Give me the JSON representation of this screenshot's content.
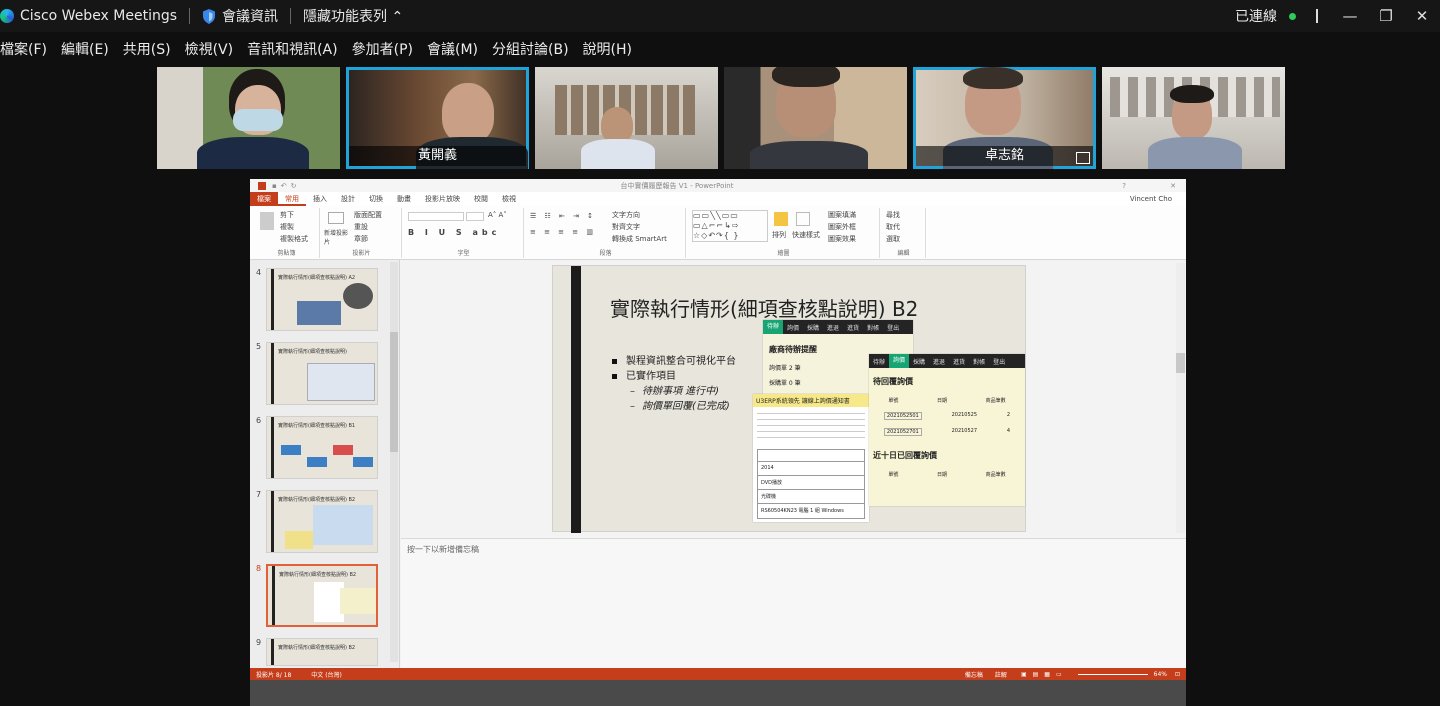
{
  "titlebar": {
    "app_name": "Cisco Webex Meetings",
    "meeting_info": "會議資訊",
    "hide_menu": "隱藏功能表列",
    "status": "已連線"
  },
  "menu": [
    "檔案(F)",
    "編輯(E)",
    "共用(S)",
    "檢視(V)",
    "音訊和視訊(A)",
    "參加者(P)",
    "會議(M)",
    "分組討論(B)",
    "說明(H)"
  ],
  "participants": [
    {
      "name": "",
      "active": false
    },
    {
      "name": "黃開義",
      "active": true
    },
    {
      "name": "",
      "active": false
    },
    {
      "name": "",
      "active": false
    },
    {
      "name": "卓志銘",
      "active": true
    },
    {
      "name": "",
      "active": false
    }
  ],
  "ppt": {
    "title": "台中實價履歷報告 V1 - PowerPoint",
    "user": "Vincent Cho",
    "tabs": [
      "檔案",
      "常用",
      "插入",
      "設計",
      "切換",
      "動畫",
      "投影片放映",
      "校閱",
      "檢視"
    ],
    "ribbon": {
      "clipboard": "剪貼簿",
      "cut": "剪下",
      "copy": "複製",
      "format_painter": "複製格式",
      "slides": "投影片",
      "new_slide": "新增投影片",
      "layout": "版面配置",
      "reset": "重設",
      "section": "章節",
      "font": "字型",
      "paragraph": "段落",
      "text_direction": "文字方向",
      "align_text": "對齊文字",
      "smartart": "轉換成 SmartArt",
      "drawing": "繪圖",
      "arrange": "排列",
      "quick_styles": "快速樣式",
      "shape_fill": "圖案填滿",
      "shape_outline": "圖案外框",
      "shape_effects": "圖案效果",
      "editing": "編輯",
      "find": "尋找",
      "replace": "取代",
      "select": "選取"
    },
    "thumbs": [
      {
        "num": "4",
        "title": "實際執行情形(細項查核點說明) A2"
      },
      {
        "num": "5",
        "title": "實際執行情形(細項查核點說明)"
      },
      {
        "num": "6",
        "title": "實際執行情形(細項查核點說明) B1"
      },
      {
        "num": "7",
        "title": "實際執行情形(細項查核點說明) B2"
      },
      {
        "num": "8",
        "title": "實際執行情形(細項查核點說明) B2"
      },
      {
        "num": "9",
        "title": "實際執行情形(細項查核點說明) B2"
      }
    ],
    "slide": {
      "title": "實際執行情形(細項查核點說明) B2",
      "bullets": [
        "製程資訊整合可視化平台",
        "已實作項目"
      ],
      "sub_bullets": [
        "待辦事項 進行中)",
        "詢價單回覆(已完成)"
      ],
      "shot1": {
        "nav": [
          "待辦",
          "詢價",
          "採購",
          "進退",
          "進貨",
          "對帳",
          "登出"
        ],
        "heading": "廠商待辦提醒",
        "line1": "詢價單 2 筆",
        "line2": "採購單 0 筆"
      },
      "shot2": {
        "nav": [
          "待辦",
          "詢價",
          "採購",
          "進退",
          "進貨",
          "對帳",
          "登出"
        ],
        "heading": "待回覆詢價",
        "columns": [
          "單號",
          "日期",
          "商品筆數"
        ],
        "rows": [
          [
            "2021052501",
            "20210525",
            "2"
          ],
          [
            "2021052701",
            "20210527",
            "4"
          ]
        ],
        "heading2": "近十日已回覆詢價",
        "columns2": [
          "單號",
          "日期",
          "商品筆數"
        ]
      },
      "shot3": {
        "banner": "U3ERP系統領先 讓線上詢價通知書",
        "rows": [
          "2014",
          "DVD播放",
          "光碟機",
          "RS60504KN23 電腦 1 組 Windows"
        ]
      }
    },
    "notes_placeholder": "按一下以新增備忘稿",
    "status_left": "投影片 8/ 18",
    "status_lang": "中文 (台灣)",
    "status_notes": "備忘稿",
    "status_comments": "註解",
    "zoom": "64%"
  },
  "colors": {
    "accent_blue": "#1fa3d8",
    "ppt_red": "#c43e1c",
    "connected_green": "#2ecb5a"
  }
}
